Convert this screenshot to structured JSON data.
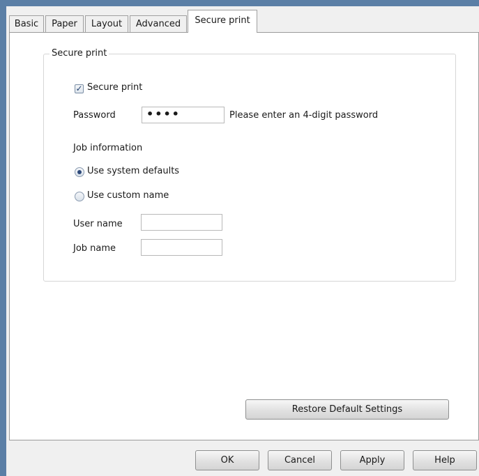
{
  "tabs": [
    {
      "label": "Basic"
    },
    {
      "label": "Paper"
    },
    {
      "label": "Layout"
    },
    {
      "label": "Advanced"
    },
    {
      "label": "Secure print",
      "active": true
    }
  ],
  "group": {
    "legend": "Secure print",
    "secure_print_checkbox": {
      "label": "Secure print",
      "checked": true
    },
    "password": {
      "label": "Password",
      "value": "••••",
      "hint": "Please enter an 4-digit password"
    },
    "job_information": {
      "label": "Job information"
    },
    "radios": [
      {
        "label": "Use system defaults",
        "selected": true
      },
      {
        "label": "Use custom name",
        "selected": false
      }
    ],
    "user_name": {
      "label": "User name",
      "value": ""
    },
    "job_name": {
      "label": "Job name",
      "value": ""
    }
  },
  "buttons": {
    "restore": "Restore Default Settings",
    "ok": "OK",
    "cancel": "Cancel",
    "apply": "Apply",
    "help": "Help"
  },
  "colors": {
    "window_frame": "#5b7fa6",
    "dialog_bg": "#f0f0f0",
    "panel_bg": "#ffffff",
    "check_mark": "#22406e"
  }
}
